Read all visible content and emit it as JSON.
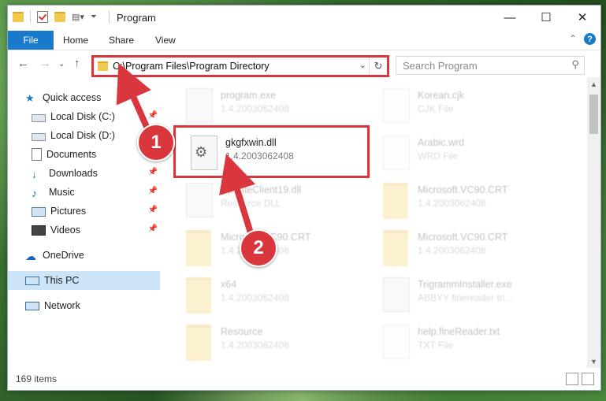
{
  "window": {
    "title": "Program"
  },
  "ribbon": {
    "file": "File",
    "home": "Home",
    "share": "Share",
    "view": "View"
  },
  "nav": {
    "address": "C:\\Program Files\\Program Directory",
    "search_placeholder": "Search Program"
  },
  "sidebar": {
    "items": [
      {
        "label": "Quick access"
      },
      {
        "label": "Local Disk (C:)"
      },
      {
        "label": "Local Disk (D:)"
      },
      {
        "label": "Documents"
      },
      {
        "label": "Downloads"
      },
      {
        "label": "Music"
      },
      {
        "label": "Pictures"
      },
      {
        "label": "Videos"
      },
      {
        "label": "OneDrive"
      },
      {
        "label": "This PC"
      },
      {
        "label": "Network"
      }
    ]
  },
  "files": [
    {
      "name": "program.exe",
      "sub": "1.4.2003062408"
    },
    {
      "name": "Korean.cjk",
      "sub": "CJK File"
    },
    {
      "name": "gkgfxwin.dll",
      "sub": "1.4.2003062408"
    },
    {
      "name": "Arabic.wrd",
      "sub": "WRD File"
    },
    {
      "name": "UpdateClient19.dll",
      "sub": "Resource DLL"
    },
    {
      "name": "Microsoft.VC90.CRT",
      "sub": "1.4.2003062408"
    },
    {
      "name": "Microsoft.VC90.CRT",
      "sub": "1.4.2003062408"
    },
    {
      "name": "Microsoft.VC90.CRT",
      "sub": "1.4.2003062408"
    },
    {
      "name": "x64",
      "sub": "1.4.2003062408"
    },
    {
      "name": "TrigrammInstaller.exe",
      "sub": "ABBYY finereader tri..."
    },
    {
      "name": "Resource",
      "sub": "1.4.2003062408"
    },
    {
      "name": "help.fineReader.txt",
      "sub": "TXT File"
    }
  ],
  "status": {
    "count": "169 items"
  },
  "markers": {
    "one": "1",
    "two": "2"
  },
  "colors": {
    "accent": "#1979ca",
    "highlight": "#d9363e"
  }
}
